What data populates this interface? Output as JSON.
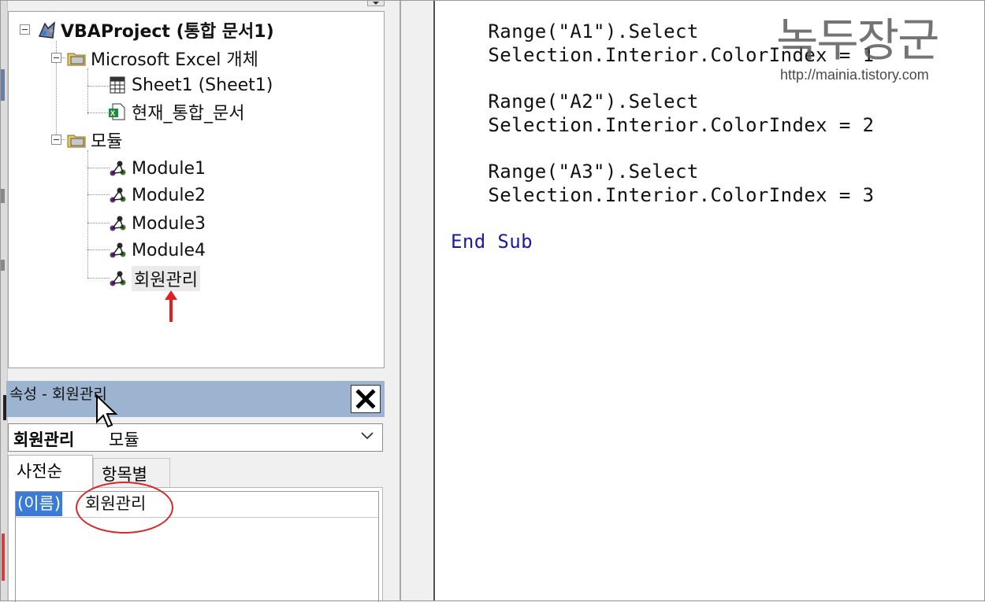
{
  "project_tree": {
    "root": "VBAProject (통합 문서1)",
    "excel_objects_folder": "Microsoft Excel 개체",
    "sheet1": "Sheet1 (Sheet1)",
    "workbook": "현재_통합_문서",
    "modules_folder": "모듈",
    "modules": [
      "Module1",
      "Module2",
      "Module3",
      "Module4",
      "회원관리"
    ]
  },
  "properties": {
    "title": "속성 - 회원관리",
    "close_symbol": "✕",
    "object_name": "회원관리",
    "object_type": "모듈",
    "tabs": [
      "사전순",
      "항목별"
    ],
    "name_key": "(이름)",
    "name_value": "회원관리"
  },
  "code": {
    "lines": [
      "    Range(\"A1\").Select",
      "    Selection.Interior.ColorIndex = 1",
      "    Range(\"A2\").Select",
      "    Selection.Interior.ColorIndex = 2",
      "    Range(\"A3\").Select",
      "    Selection.Interior.ColorIndex = 3"
    ],
    "end_kw1": "End",
    "end_kw2": "Sub"
  },
  "watermark": {
    "title": "녹두장군",
    "url": "http://mainia.tistory.com"
  },
  "colors": {
    "selection_blue": "#3b7bd8",
    "annotation_red": "#d42a2a",
    "properties_title_bg": "#9db4d1",
    "keyword_blue": "#1a1aa6"
  }
}
